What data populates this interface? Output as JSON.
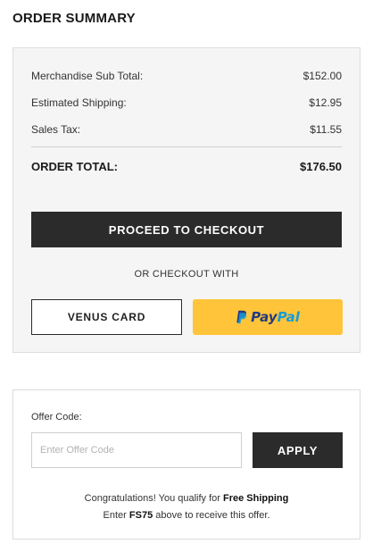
{
  "page_title": "ORDER SUMMARY",
  "summary": {
    "rows": [
      {
        "label": "Merchandise Sub Total:",
        "value": "$152.00"
      },
      {
        "label": "Estimated Shipping:",
        "value": "$12.95"
      },
      {
        "label": "Sales Tax:",
        "value": "$11.55"
      }
    ],
    "total_label": "ORDER TOTAL:",
    "total_value": "$176.50"
  },
  "checkout": {
    "proceed_label": "PROCEED TO CHECKOUT",
    "or_text": "OR CHECKOUT WITH",
    "venus_card_label": "VENUS CARD",
    "paypal": {
      "part1": "Pay",
      "part2": "Pal",
      "icon": "paypal-icon"
    }
  },
  "offer": {
    "label": "Offer Code:",
    "input_value": "",
    "input_placeholder": "Enter Offer Code",
    "apply_label": "APPLY",
    "message": {
      "line1_prefix": "Congratulations! You qualify for ",
      "line1_bold": "Free Shipping",
      "line2_prefix": "Enter ",
      "line2_code": "FS75",
      "line2_suffix": " above to receive this offer."
    }
  },
  "colors": {
    "dark_button": "#2b2b2b",
    "paypal_yellow": "#ffc439",
    "paypal_dark_blue": "#253b80",
    "paypal_light_blue": "#179bd7",
    "summary_bg": "#f5f5f5"
  }
}
